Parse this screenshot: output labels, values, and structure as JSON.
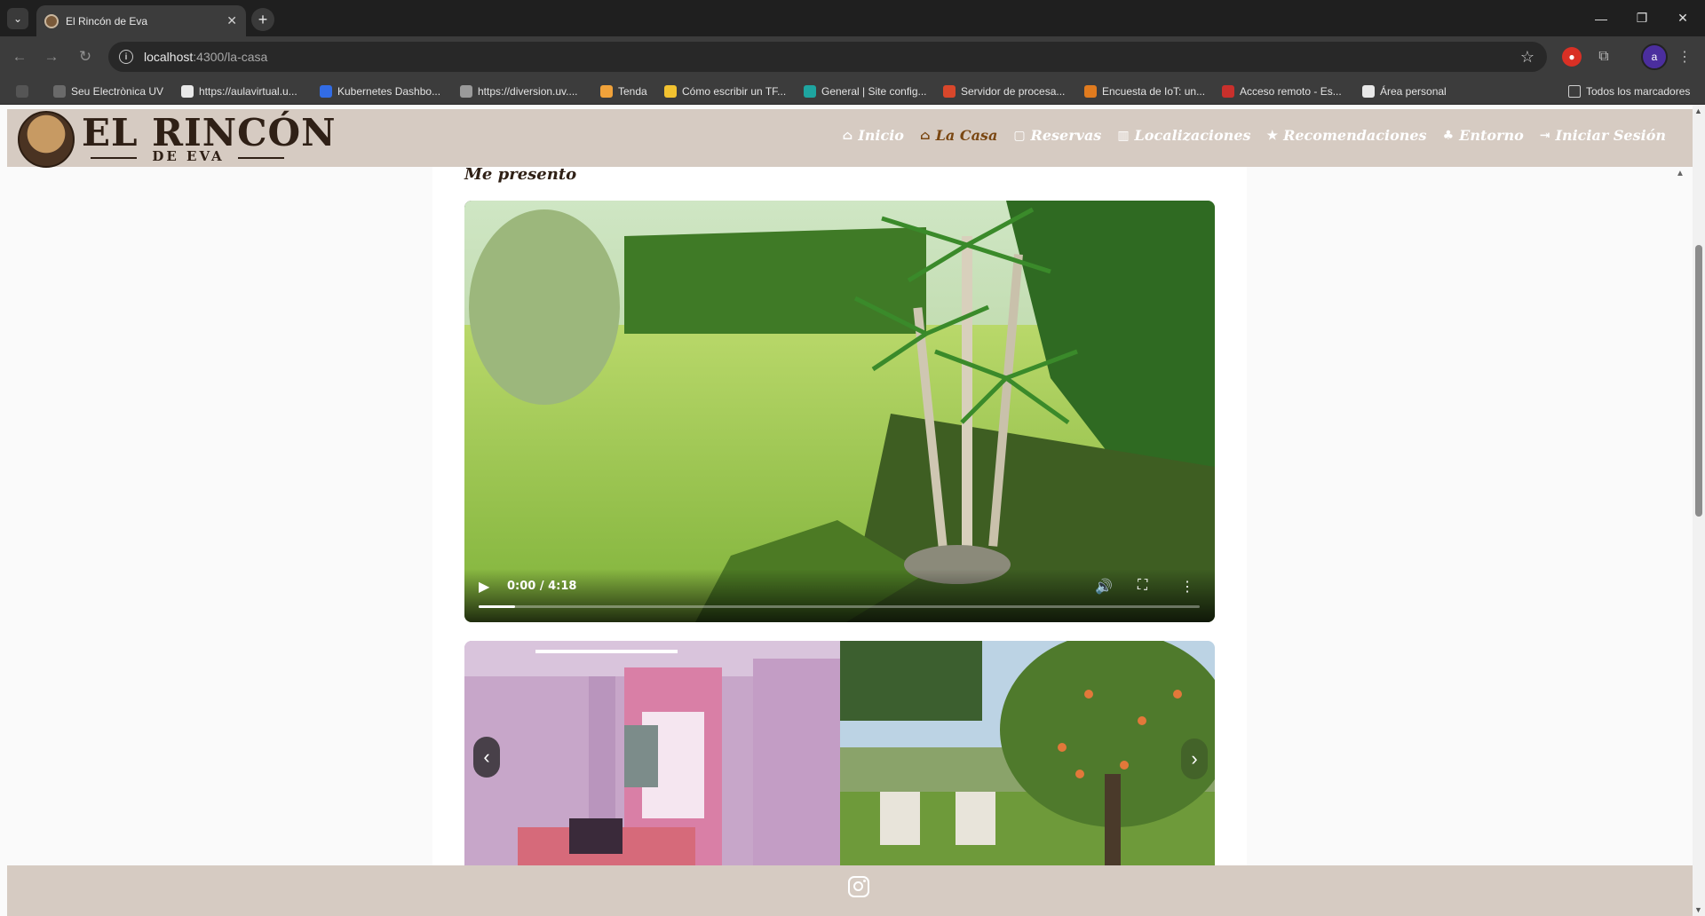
{
  "browser": {
    "tab_title": "El Rincón de Eva",
    "url_host": "localhost",
    "url_rest": ":4300/la-casa",
    "profile_initial": "a",
    "bookmarks": [
      {
        "label": "Seu Electrònica UV",
        "color": "#6a6a6a"
      },
      {
        "label": "https://aulavirtual.u...",
        "color": "#e8e8e8"
      },
      {
        "label": "Kubernetes Dashbo...",
        "color": "#326ce5"
      },
      {
        "label": "https://diversion.uv....",
        "color": "#9a9a9a"
      },
      {
        "label": "Tenda",
        "color": "#f0a23a"
      },
      {
        "label": "Cómo escribir un TF...",
        "color": "#f2c230"
      },
      {
        "label": "General | Site config...",
        "color": "#1ea5a0"
      },
      {
        "label": "Servidor de procesa...",
        "color": "#d9472b"
      },
      {
        "label": "Encuesta de IoT: un...",
        "color": "#e07b1f"
      },
      {
        "label": "Acceso remoto - Es...",
        "color": "#c9302c"
      },
      {
        "label": "Área personal",
        "color": "#e8e8e8"
      }
    ],
    "all_bookmarks": "Todos los marcadores"
  },
  "site": {
    "logo_main": "EL RINCÓN",
    "logo_sub": "DE EVA",
    "nav": [
      {
        "label": "Inicio",
        "icon": "home-icon",
        "glyph": "⌂",
        "active": false
      },
      {
        "label": "La Casa",
        "icon": "house-icon",
        "glyph": "⌂",
        "active": true
      },
      {
        "label": "Reservas",
        "icon": "calendar-icon",
        "glyph": "▢",
        "active": false
      },
      {
        "label": "Localizaciones",
        "icon": "map-icon",
        "glyph": "▥",
        "active": false
      },
      {
        "label": "Recomendaciones",
        "icon": "star-icon",
        "glyph": "★",
        "active": false
      },
      {
        "label": "Entorno",
        "icon": "bell-icon",
        "glyph": "♣",
        "active": false
      },
      {
        "label": "Iniciar Sesión",
        "icon": "login-icon",
        "glyph": "⇥",
        "active": false
      }
    ]
  },
  "main": {
    "section_title": "Me presento",
    "video": {
      "time_display": "0:00 / 4:18",
      "progress_fraction": 0.05
    }
  },
  "colors": {
    "header_bg": "#d6cbc2",
    "active_nav": "#7a4712"
  }
}
